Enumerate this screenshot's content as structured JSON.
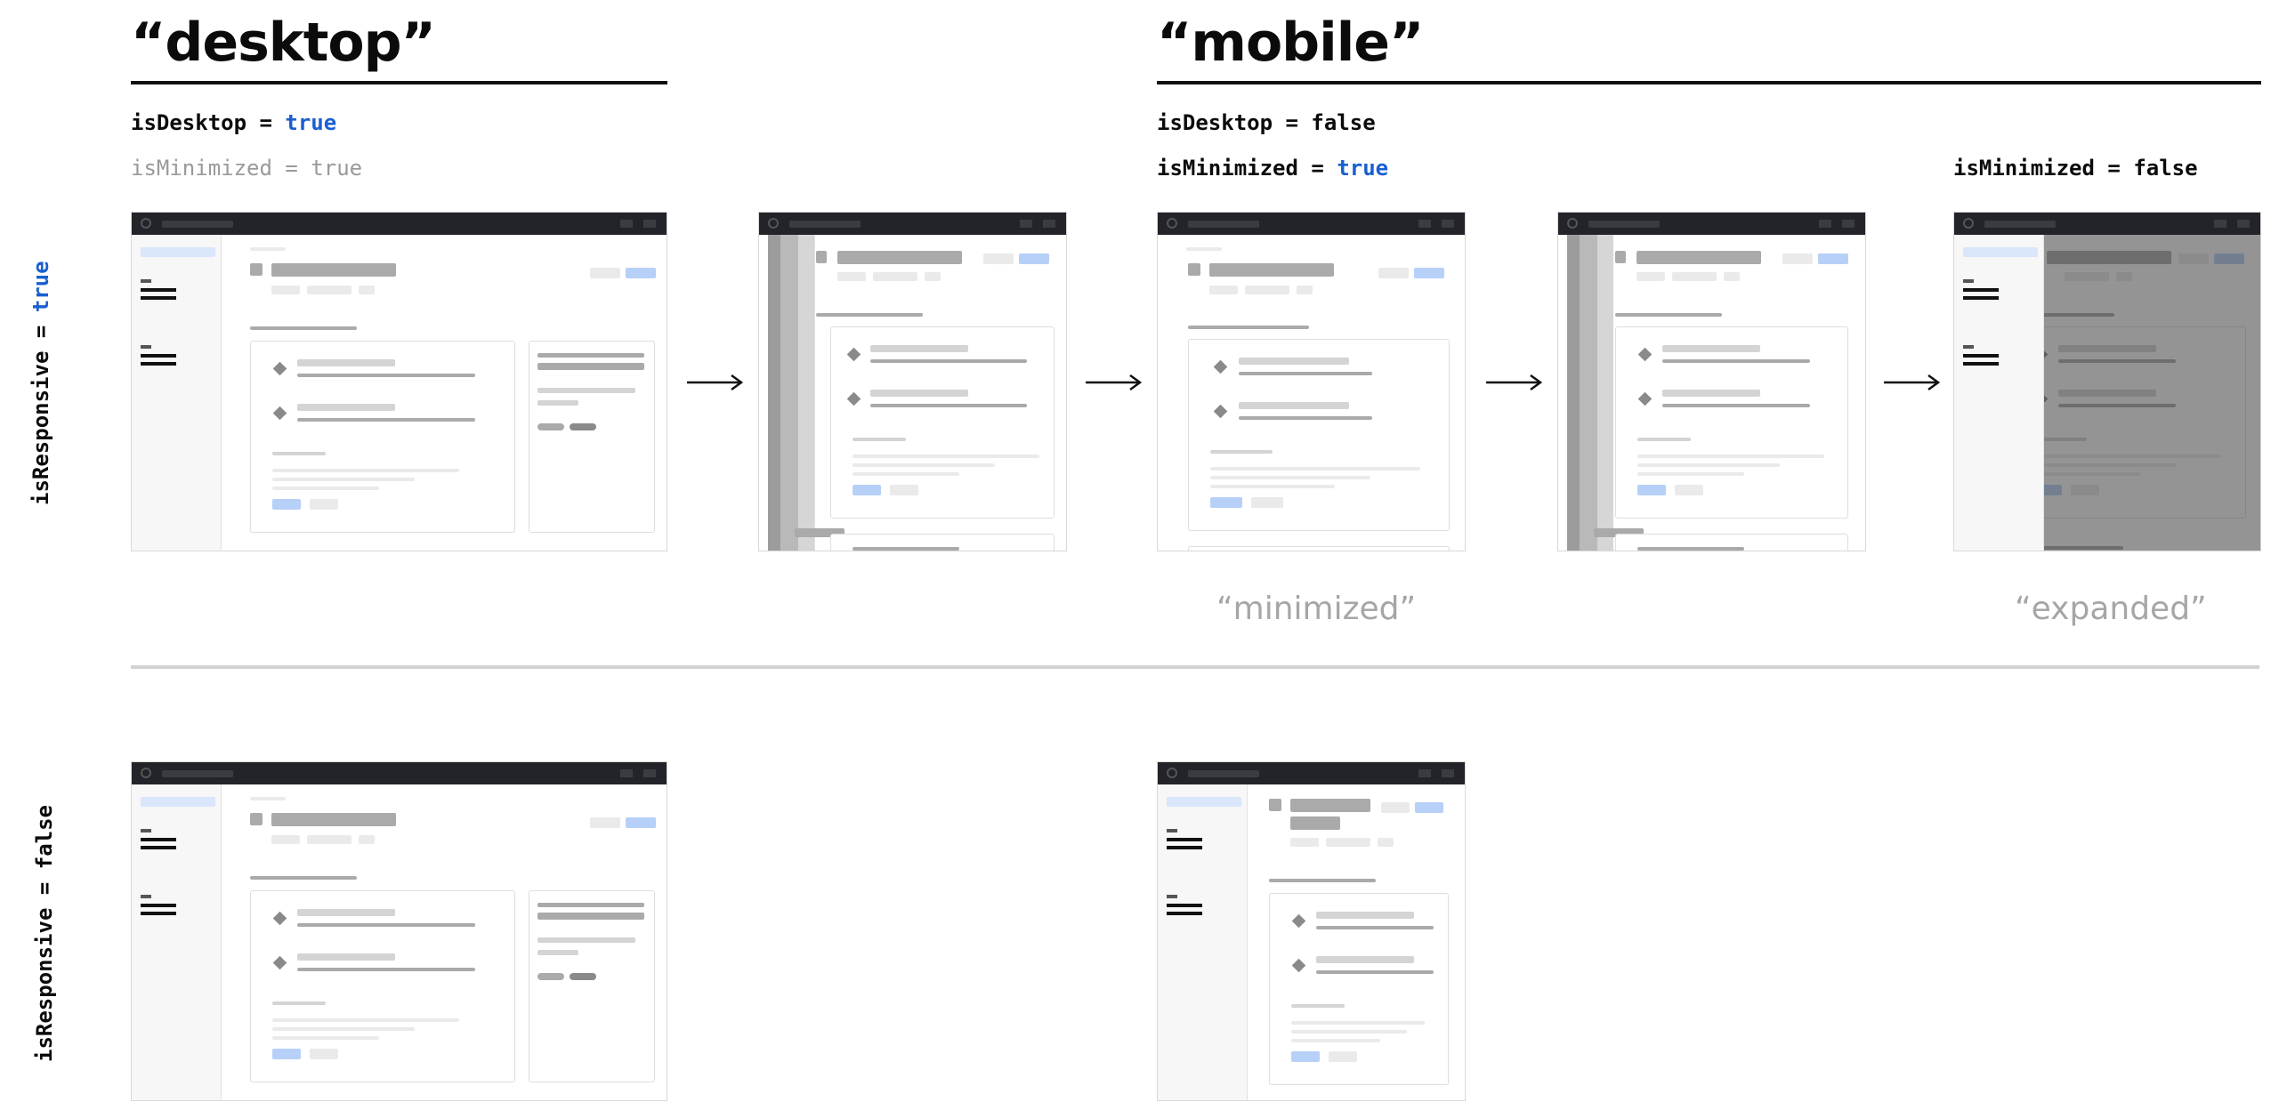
{
  "headings": {
    "desktop": "“desktop”",
    "mobile": "“mobile”"
  },
  "desktop_column": {
    "is_desktop": {
      "name": "isDesktop",
      "op": "=",
      "value": "true"
    },
    "is_minimized": {
      "name": "isMinimized",
      "op": "=",
      "value": "true"
    }
  },
  "mobile_column": {
    "is_desktop": {
      "name": "isDesktop",
      "op": "=",
      "value": "false"
    },
    "is_minimized_true": {
      "name": "isMinimized",
      "op": "=",
      "value": "true"
    },
    "is_minimized_false": {
      "name": "isMinimized",
      "op": "=",
      "value": "false"
    }
  },
  "rows": {
    "responsive_true": {
      "name": "isResponsive",
      "op": "=",
      "value": "true"
    },
    "responsive_false": {
      "name": "isResponsive",
      "op": "=",
      "value": "false"
    }
  },
  "captions": {
    "minimized": "“minimized”",
    "expanded": "“expanded”"
  },
  "colors": {
    "accent": "#1a5fd1",
    "titlebar": "#222429",
    "muted": "#a6a6a6"
  },
  "icons": {
    "arrow": "right-arrow-icon",
    "hamburger": "hamburger-icon",
    "diamond": "diamond-icon"
  }
}
